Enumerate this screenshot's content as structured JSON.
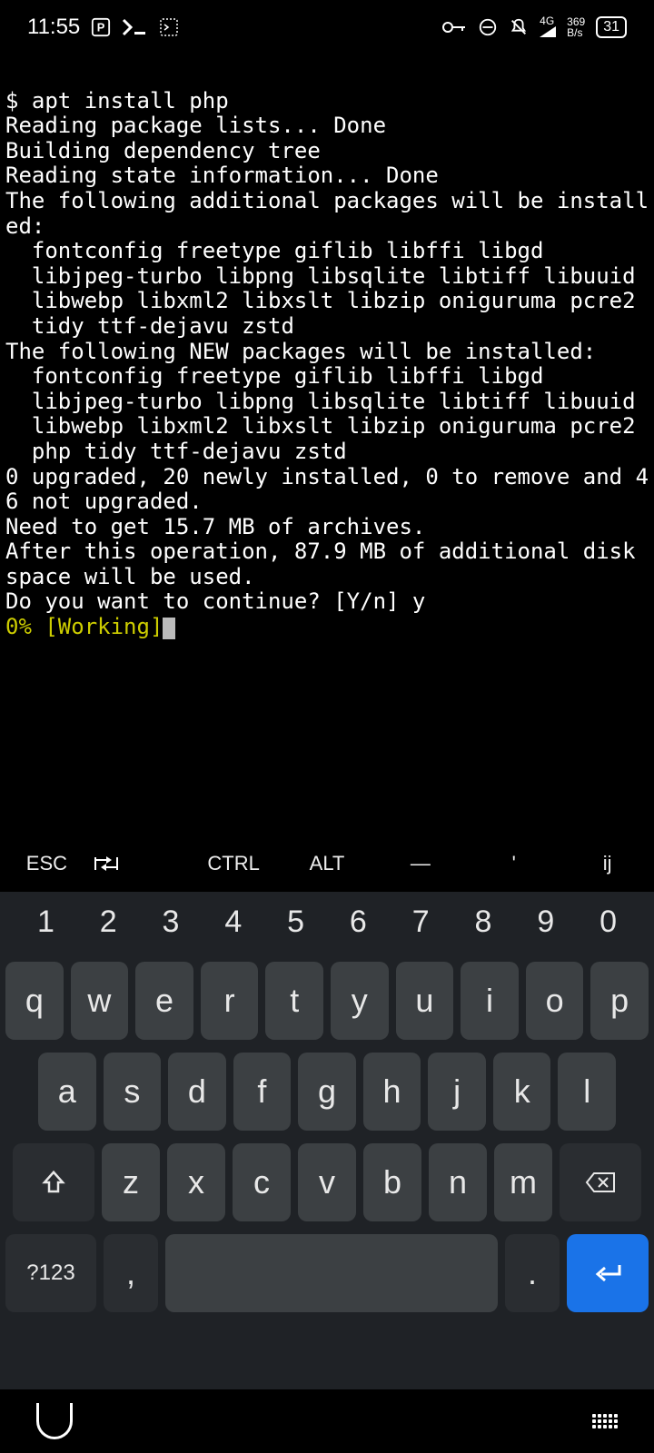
{
  "statusbar": {
    "time": "11:55",
    "net_label": "4G",
    "speed": "369",
    "speed_unit": "B/s",
    "battery": "31"
  },
  "terminal": {
    "prompt": "$ apt install php",
    "line2": "Reading package lists... Done",
    "line3": "Building dependency tree",
    "line4": "Reading state information... Done",
    "line5": "The following additional packages will be installed:",
    "pkgs1a": "  fontconfig freetype giflib libffi libgd",
    "pkgs1b": "  libjpeg-turbo libpng libsqlite libtiff libuuid",
    "pkgs1c": "  libwebp libxml2 libxslt libzip oniguruma pcre2",
    "pkgs1d": "  tidy ttf-dejavu zstd",
    "line6": "The following NEW packages will be installed:",
    "pkgs2a": "  fontconfig freetype giflib libffi libgd",
    "pkgs2b": "  libjpeg-turbo libpng libsqlite libtiff libuuid",
    "pkgs2c": "  libwebp libxml2 libxslt libzip oniguruma pcre2",
    "pkgs2d": "  php tidy ttf-dejavu zstd",
    "line7": "0 upgraded, 20 newly installed, 0 to remove and 46 not upgraded.",
    "line8": "Need to get 15.7 MB of archives.",
    "line9": "After this operation, 87.9 MB of additional disk space will be used.",
    "line10": "Do you want to continue? [Y/n] y",
    "progress": "0% [Working]"
  },
  "termkeys": {
    "esc": "ESC",
    "tab": "⇥",
    "ctrl": "CTRL",
    "alt": "ALT",
    "dash": "—",
    "apos": "'",
    "ij": "ij"
  },
  "keyboard": {
    "numbers": [
      "1",
      "2",
      "3",
      "4",
      "5",
      "6",
      "7",
      "8",
      "9",
      "0"
    ],
    "row1": [
      "q",
      "w",
      "e",
      "r",
      "t",
      "y",
      "u",
      "i",
      "o",
      "p"
    ],
    "row2": [
      "a",
      "s",
      "d",
      "f",
      "g",
      "h",
      "j",
      "k",
      "l"
    ],
    "row3": [
      "z",
      "x",
      "c",
      "v",
      "b",
      "n",
      "m"
    ],
    "symbols": "?123",
    "comma": ",",
    "period": "."
  }
}
